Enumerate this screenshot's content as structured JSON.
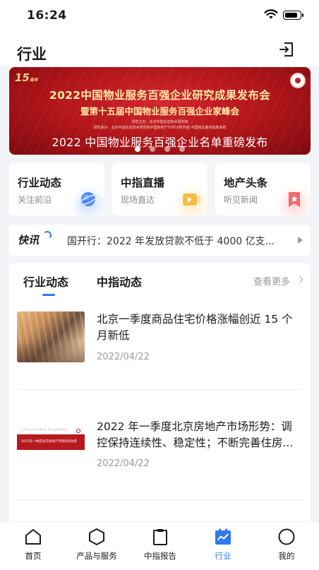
{
  "status_bar": {
    "time": "16:24",
    "battery_level": 0.85
  },
  "header": {
    "title": "行业",
    "exit_icon": "exit-icon"
  },
  "banner": {
    "badge_number": "15",
    "badge_suffix": "周年",
    "line1": "2022中国物业服务百强企业研究成果发布会",
    "line2": "暨第十五届中国物业服务百强企业家峰会",
    "small1": "研究主办：北京中指信息技术研究院",
    "small2": "研究承办：北京中指信息技术研究院中国房地产TOP10研究组  中国物业服务指数系统",
    "caption": "2022 中国物业服务百强企业名单重磅发布",
    "dots": 4,
    "active_dot": 0
  },
  "categories": [
    {
      "title": "行业动态",
      "subtitle": "关注前沿",
      "icon": "planet-icon",
      "color": "#3b7cf5"
    },
    {
      "title": "中指直播",
      "subtitle": "现场直达",
      "icon": "video-icon",
      "color": "#f5b53b"
    },
    {
      "title": "地产头条",
      "subtitle": "听见新闻",
      "icon": "bookmark-icon",
      "color": "#ef5a5a"
    }
  ],
  "flash": {
    "logo": "快讯",
    "text": "国开行：2022 年发放贷款不低于 4000 亿支..."
  },
  "news": {
    "tabs": [
      "行业动态",
      "中指动态"
    ],
    "more_label": "查看更多",
    "items": [
      {
        "title": "北京一季度商品住宅价格涨幅创近 15 个月新低",
        "date": "2022/04/22"
      },
      {
        "title": "2022 年一季度北京房地产市场形势：调控保持连续性、稳定性；不断完善住房...",
        "date": "2022/04/22",
        "thumb_brand": "China Index Academy",
        "thumb_title": "2022年一季度北京房地产市场形势总结"
      }
    ]
  },
  "tabbar": {
    "items": [
      {
        "label": "首页",
        "icon": "home-icon"
      },
      {
        "label": "产品与服务",
        "icon": "hexagon-icon"
      },
      {
        "label": "中指报告",
        "icon": "clipboard-icon"
      },
      {
        "label": "行业",
        "icon": "chart-icon"
      },
      {
        "label": "我的",
        "icon": "profile-icon"
      }
    ],
    "active_index": 3,
    "accent": "#2f78f2"
  }
}
